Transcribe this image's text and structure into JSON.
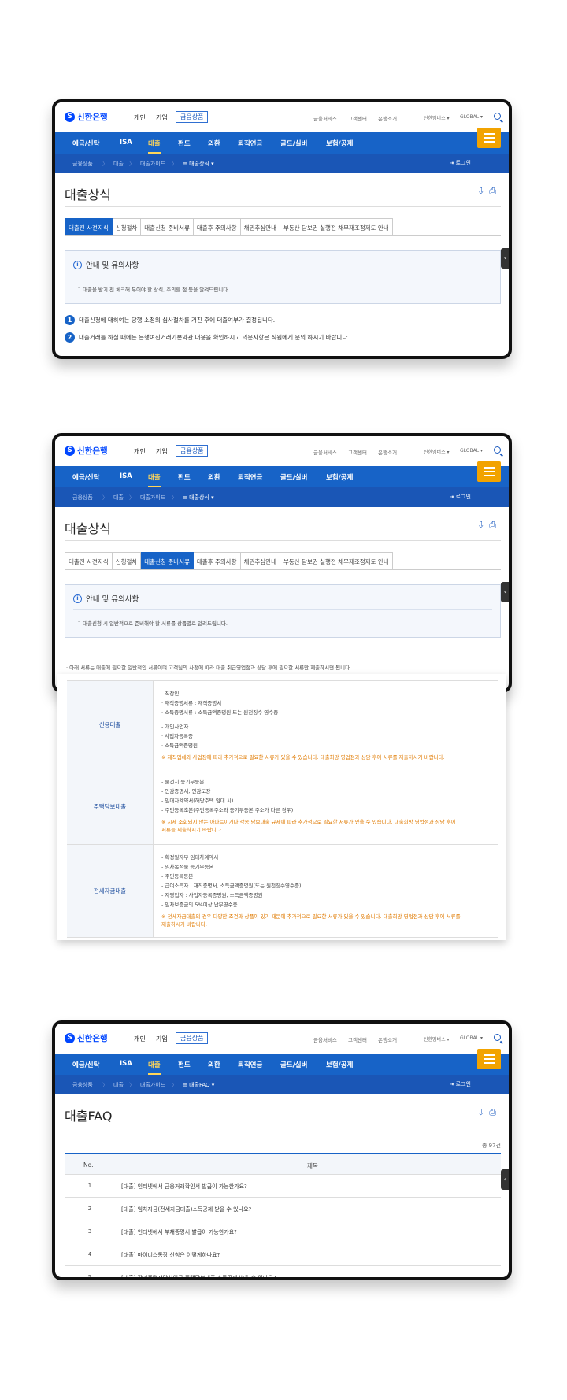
{
  "header": {
    "logo": "신한은행",
    "nav_personal": "개인",
    "nav_corporate": "기업",
    "nav_products": "금융상품",
    "util_services": "금융서비스",
    "util_customer": "고객센터",
    "util_about": "은행소개",
    "util_family": "신한멤버스 ▾",
    "util_global": "GLOBAL ▾"
  },
  "gnb": [
    "예금/신탁",
    "ISA",
    "대출",
    "펀드",
    "외환",
    "퇴직연금",
    "골드/실버",
    "보험/공제"
  ],
  "login": "로그인",
  "screens": [
    {
      "breadcrumb": [
        "금융상품",
        "대출",
        "대출가이드",
        "≡ 대출상식 ▾"
      ],
      "page_title": "대출상식",
      "tabs": [
        "대출전 사전지식",
        "신청절차",
        "대출신청 준비서류",
        "대출후 주의사항",
        "채권추심안내",
        "부동산 담보권 실행전 채무재조정제도 안내"
      ],
      "active_tab": 0,
      "notice_title": "안내 및 유의사항",
      "notice_text": "대출을 받기 전 체크해 두어야 할 상식, 주의할 점 등을 알려드립니다.",
      "items": [
        {
          "no": "1",
          "text": "대출신청에 대하여는 당행 소정의 심사절차를 거친 후에 대출여부가 결정됩니다."
        },
        {
          "no": "2",
          "text": "대출거래를 하실 때에는 은행여신거래기본약관 내용을 확인하시고 의문사항은 직원에게 문의 하시기 바랍니다."
        }
      ]
    },
    {
      "breadcrumb": [
        "금융상품",
        "대출",
        "대출가이드",
        "≡ 대출상식 ▾"
      ],
      "page_title": "대출상식",
      "tabs": [
        "대출전 사전지식",
        "신청절차",
        "대출신청 준비서류",
        "대출후 주의사항",
        "채권추심안내",
        "부동산 담보권 실행전 채무재조정제도 안내"
      ],
      "active_tab": 2,
      "notice_title": "안내 및 유의사항",
      "notice_text": "대출신청 시 일반적으로 준비해야 할 서류를 상품별로 알려드립니다.",
      "table_note": "· 아래 서류는 대출에 필요한 일반적인 서류이며 고객님의 사정에 따라 대출 취급영업점과 상담 후에 필요한 서류만 제출하시면 됩니다.",
      "doc_rows": [
        {
          "category": "신용대출",
          "lines": [
            "- 직장인",
            "  · 재직증명서류 : 재직증명서",
            "  · 소득증명서류 : 소득금액증명원 또는 원천징수 영수증",
            "",
            "- 개인사업자",
            "  · 사업자등록증",
            "  · 소득금액증명원"
          ],
          "warning": [
            "※ 재직업체와 사업장에 따라 추가적으로 필요한 서류가 있을 수 있습니다. 대출희망 영업점과 상담 후에 서류를 제출하시기 바랍니다."
          ]
        },
        {
          "category": "주택담보대출",
          "lines": [
            "- 물건지 등기부등본",
            "- 인감증명서, 인감도장",
            "- 임대차계약서(해당주택 임대 시)",
            "- 주민등록초본(주민등록주소와 등기부등본 주소가 다른 경우)"
          ],
          "warning": [
            "※ 시세 조회되지 않는 아파트이거나 각종 담보대출 규제에 따라 추가적으로 필요한 서류가 있을 수 있습니다. 대출희망 영업점과 상담 후에",
            "   서류를 제출하시기 바랍니다."
          ]
        },
        {
          "category": "전세자금대출",
          "lines": [
            "- 확정일자부 임대차계약서",
            "- 임차목적물 등기부등본",
            "- 주민등록등본",
            "- 급여소득자 : 재직증명서, 소득금액증명원(또는 원천징수영수증)",
            "- 자영업자 : 사업자등록증명원, 소득금액증명원",
            "- 임차보증금의 5%이상 납부영수증"
          ],
          "warning": [
            "※ 전세자금대출의 경우 다양한 조건과 상품이 있기 때문에 추가적으로 필요한 서류가 있을 수 있습니다. 대출희망 영업점과 상담 후에 서류를",
            "   제출하시기 바랍니다."
          ]
        }
      ]
    },
    {
      "breadcrumb": [
        "금융상품",
        "대출",
        "대출가이드",
        "≡ 대출FAQ ▾"
      ],
      "page_title": "대출FAQ",
      "total": "총 97건",
      "col_no": "No.",
      "col_title": "제목",
      "faq": [
        {
          "no": "1",
          "title": "[대출] 인터넷에서 금융거래확인서 발급이 가능한가요?"
        },
        {
          "no": "2",
          "title": "[대출] 임차자금(전세자금대출)소득공제 받을 수 있나요?"
        },
        {
          "no": "3",
          "title": "[대출] 인터넷에서 부채증명서 발급이 가능한가요?"
        },
        {
          "no": "4",
          "title": "[대출] 마이너스통장 신청은 어떻게하나요?"
        },
        {
          "no": "5",
          "title": "[대출] 장기주택저당차입금 주택담보대출 소득공제 받을 수 있나요?"
        }
      ]
    }
  ],
  "colors": {
    "primary": "#1763c7",
    "sub_nav": "#1a56b6",
    "menu_button": "#f2a300",
    "warning_text": "#e07a00"
  }
}
